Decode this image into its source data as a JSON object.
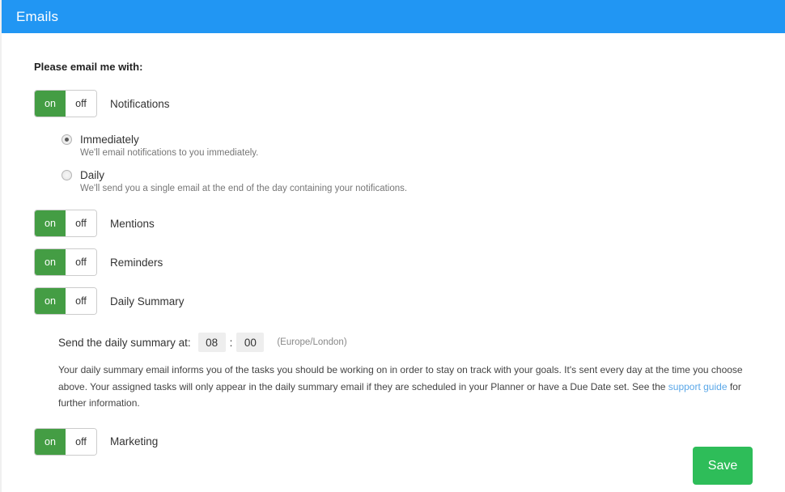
{
  "header": {
    "title": "Emails"
  },
  "main": {
    "section_heading": "Please email me with:",
    "toggles": [
      {
        "on_label": "on",
        "off_label": "off",
        "label": "Notifications",
        "state": "on"
      },
      {
        "on_label": "on",
        "off_label": "off",
        "label": "Mentions",
        "state": "on"
      },
      {
        "on_label": "on",
        "off_label": "off",
        "label": "Reminders",
        "state": "on"
      },
      {
        "on_label": "on",
        "off_label": "off",
        "label": "Daily Summary",
        "state": "on"
      },
      {
        "on_label": "on",
        "off_label": "off",
        "label": "Marketing",
        "state": "on"
      }
    ],
    "notification_frequency": {
      "options": [
        {
          "label": "Immediately",
          "help": "We'll email notifications to you immediately.",
          "selected": true
        },
        {
          "label": "Daily",
          "help": "We'll send you a single email at the end of the day containing your notifications.",
          "selected": false
        }
      ]
    },
    "daily_summary": {
      "time_label": "Send the daily summary at:",
      "hour": "08",
      "separator": ":",
      "minute": "00",
      "timezone": "(Europe/London)",
      "paragraph_part1": "Your daily summary email informs you of the tasks you should be working on in order to stay on track with your goals. It's sent every day at the time you choose above. Your assigned tasks will only appear in the daily summary email if they are scheduled in your Planner or have a Due Date set. See the ",
      "link_text": "support guide",
      "paragraph_part2": " for further information."
    }
  },
  "footer": {
    "save_label": "Save"
  },
  "colors": {
    "header_blue": "#2196f3",
    "toggle_green": "#449d44",
    "save_green": "#2ebd59",
    "link_blue": "#5aa7e8"
  }
}
